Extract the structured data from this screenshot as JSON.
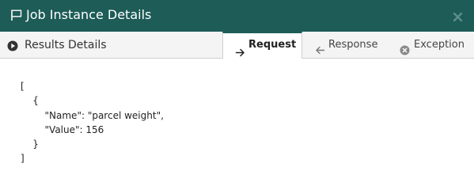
{
  "dialog": {
    "title": "Job Instance Details"
  },
  "tabs": {
    "results_details": "Results Details",
    "request": "Request",
    "response": "Response",
    "exception": "Exception",
    "active": "request"
  },
  "content": {
    "request_body": "[\n    {\n        \"Name\": \"parcel weight\",\n        \"Value\": 156\n    }\n]"
  },
  "colors": {
    "header": "#1d5c57",
    "tab_bar": "#f4f4f4"
  },
  "icons": {
    "title": "flag-icon",
    "close": "close-icon",
    "results": "play-circle-icon",
    "request": "arrow-right-icon",
    "response": "arrow-left-icon",
    "exception": "x-circle-icon"
  }
}
